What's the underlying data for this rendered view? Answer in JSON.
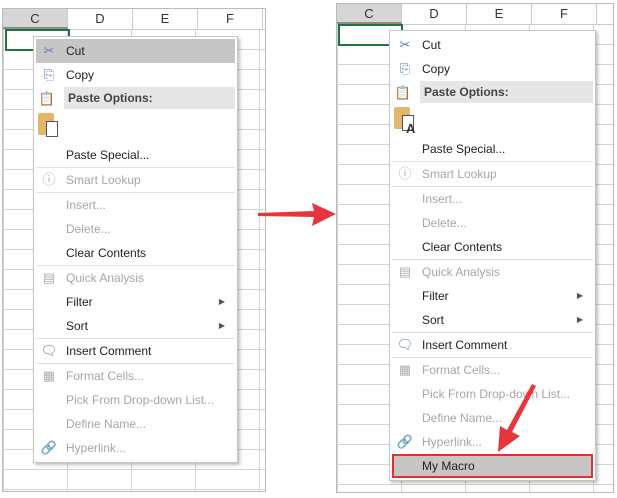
{
  "columns": [
    "C",
    "D",
    "E",
    "F"
  ],
  "before": {
    "items": [
      {
        "label": "Cut",
        "icon": "scissors-icon",
        "state": "hover"
      },
      {
        "label": "Copy",
        "icon": "copy-icon"
      },
      {
        "label": "Paste Options:",
        "icon": "clipboard-icon",
        "type": "header"
      },
      {
        "label": "",
        "icon": "paste-icon",
        "type": "icons"
      },
      {
        "label": "Paste Special..."
      },
      {
        "label": "Smart Lookup",
        "icon": "lookup-icon",
        "state": "dis",
        "sep": true
      },
      {
        "label": "Insert...",
        "state": "dis",
        "sep": true
      },
      {
        "label": "Delete...",
        "state": "dis"
      },
      {
        "label": "Clear Contents"
      },
      {
        "label": "Quick Analysis",
        "icon": "quick-analysis-icon",
        "state": "dis",
        "sep": true
      },
      {
        "label": "Filter",
        "sub": true
      },
      {
        "label": "Sort",
        "sub": true
      },
      {
        "label": "Insert Comment",
        "icon": "comment-icon",
        "sep": true
      },
      {
        "label": "Format Cells...",
        "icon": "format-cells-icon",
        "state": "dis",
        "sep": true
      },
      {
        "label": "Pick From Drop-down List...",
        "state": "dis"
      },
      {
        "label": "Define Name...",
        "state": "dis"
      },
      {
        "label": "Hyperlink...",
        "icon": "hyperlink-icon",
        "state": "dis"
      }
    ]
  },
  "after": {
    "items": [
      {
        "label": "Cut",
        "icon": "scissors-icon"
      },
      {
        "label": "Copy",
        "icon": "copy-icon"
      },
      {
        "label": "Paste Options:",
        "icon": "clipboard-icon",
        "type": "header"
      },
      {
        "label": "",
        "icon": "paste-text-icon",
        "type": "icons",
        "glyph": "A"
      },
      {
        "label": "Paste Special..."
      },
      {
        "label": "Smart Lookup",
        "icon": "lookup-icon",
        "state": "dis",
        "sep": true
      },
      {
        "label": "Insert...",
        "state": "dis",
        "sep": true
      },
      {
        "label": "Delete...",
        "state": "dis"
      },
      {
        "label": "Clear Contents"
      },
      {
        "label": "Quick Analysis",
        "icon": "quick-analysis-icon",
        "state": "dis",
        "sep": true
      },
      {
        "label": "Filter",
        "sub": true
      },
      {
        "label": "Sort",
        "sub": true
      },
      {
        "label": "Insert Comment",
        "icon": "comment-icon",
        "sep": true
      },
      {
        "label": "Format Cells...",
        "icon": "format-cells-icon",
        "state": "dis",
        "sep": true
      },
      {
        "label": "Pick From Drop-down List...",
        "state": "dis"
      },
      {
        "label": "Define Name...",
        "state": "dis"
      },
      {
        "label": "Hyperlink...",
        "icon": "hyperlink-icon",
        "state": "dis"
      },
      {
        "label": "My Macro",
        "state": "boxed"
      }
    ]
  },
  "icon_glyphs": {
    "scissors-icon": "✂",
    "copy-icon": "⎘",
    "clipboard-icon": "📋",
    "lookup-icon": "ⓘ",
    "quick-analysis-icon": "▤",
    "comment-icon": "🗨",
    "format-cells-icon": "▦",
    "hyperlink-icon": "🔗"
  },
  "colors": {
    "arrow": "#e8343a",
    "highlight_box": "#e03030"
  }
}
